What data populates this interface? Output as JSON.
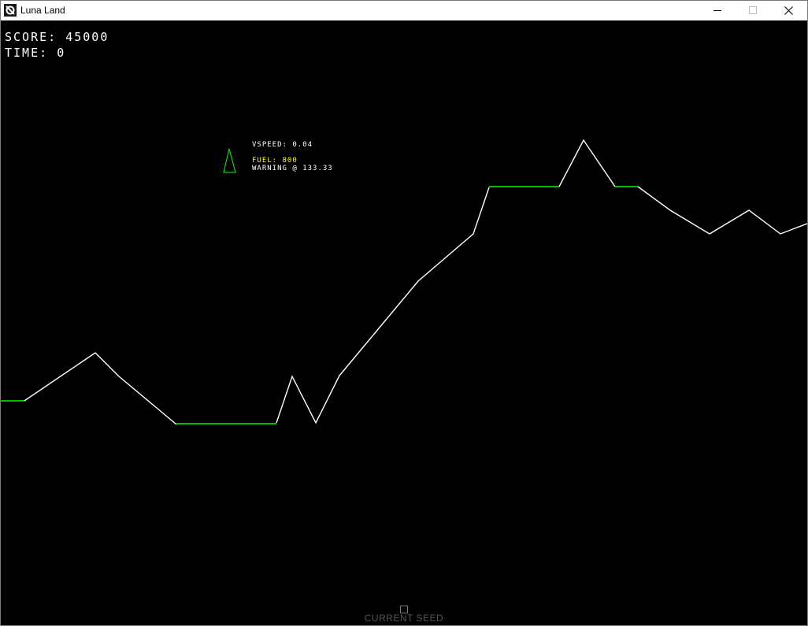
{
  "window": {
    "title": "Luna Land",
    "icon": "app-icon"
  },
  "hud": {
    "score_label": "SCORE:",
    "score_value": "45000",
    "time_label": "TIME:",
    "time_value": "0",
    "vspeed_label": "VSPEED:",
    "vspeed_value": "0.04",
    "fuel_label": "FUEL:",
    "fuel_value": "800",
    "warning_label": "WARNING @",
    "warning_value": "133.33"
  },
  "footer": {
    "seed_label": "CURRENT SEED",
    "seed_value": ""
  },
  "colors": {
    "background": "#000000",
    "terrain": "#ffffff",
    "landing_pad": "#00ff00",
    "lander": "#00ff00",
    "fuel_text": "#ffff00",
    "seed_text": "#555555"
  }
}
